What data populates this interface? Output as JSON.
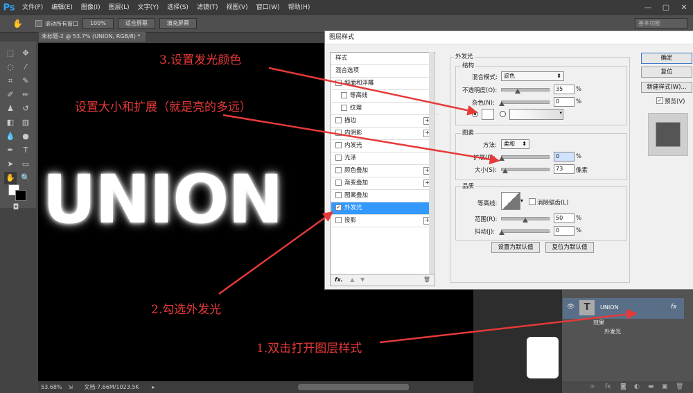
{
  "app": {
    "logo": "Ps"
  },
  "menubar": {
    "items": [
      "文件(F)",
      "编辑(E)",
      "图像(I)",
      "图层(L)",
      "文字(Y)",
      "选择(S)",
      "滤镜(T)",
      "视图(V)",
      "窗口(W)",
      "帮助(H)"
    ]
  },
  "window_controls": {
    "min": "—",
    "max": "▢",
    "close": "✕"
  },
  "options_bar": {
    "checkbox_label": "滚动所有窗口",
    "zoom_btn": "100%",
    "fit_btn": "适合屏幕",
    "fill_btn": "填充屏幕",
    "workspace": "基本功能"
  },
  "document": {
    "tab": "未标题-2 @ 53.7% (UNION, RGB/8) *",
    "canvas_text": "UNION",
    "status_zoom": "53.68%",
    "status_doc": "文档:7.66M/1023.5K"
  },
  "dialog": {
    "title": "图层样式",
    "styles": [
      {
        "label": "样式",
        "checkbox": false,
        "plus": false
      },
      {
        "label": "混合选项",
        "checkbox": false,
        "plus": false
      },
      {
        "label": "斜面和浮雕",
        "checkbox": true,
        "plus": false
      },
      {
        "label": "等高线",
        "checkbox": true,
        "plus": false
      },
      {
        "label": "纹理",
        "checkbox": true,
        "plus": false
      },
      {
        "label": "描边",
        "checkbox": true,
        "plus": true
      },
      {
        "label": "内阴影",
        "checkbox": true,
        "plus": true
      },
      {
        "label": "内发光",
        "checkbox": true,
        "plus": false
      },
      {
        "label": "光泽",
        "checkbox": true,
        "plus": false
      },
      {
        "label": "颜色叠加",
        "checkbox": true,
        "plus": true
      },
      {
        "label": "渐变叠加",
        "checkbox": true,
        "plus": true
      },
      {
        "label": "图案叠加",
        "checkbox": true,
        "plus": false
      },
      {
        "label": "外发光",
        "checkbox": true,
        "plus": false,
        "selected": true
      },
      {
        "label": "投影",
        "checkbox": true,
        "plus": true
      }
    ],
    "footer_fx": "fx.",
    "section_title": "外发光",
    "structure": {
      "title": "结构",
      "blend_label": "混合模式:",
      "blend_value": "滤色",
      "opacity_label": "不透明度(O):",
      "opacity_value": "35",
      "noise_label": "杂色(N):",
      "noise_value": "0",
      "pct": "%"
    },
    "elements": {
      "title": "图素",
      "method_label": "方法:",
      "method_value": "柔和",
      "spread_label": "扩展(P):",
      "spread_value": "0",
      "size_label": "大小(S):",
      "size_value": "73",
      "px": "像素"
    },
    "quality": {
      "title": "品质",
      "contour_label": "等高线:",
      "antialias_label": "消除锯齿(L)",
      "range_label": "范围(R):",
      "range_value": "50",
      "jitter_label": "抖动(J):",
      "jitter_value": "0"
    },
    "default_btn": "设置为默认值",
    "reset_default_btn": "复位为默认值",
    "ok": "确定",
    "reset": "复位",
    "new_style": "新建样式(W)...",
    "preview": "预览(V)"
  },
  "layers": {
    "layer_name": "UNION",
    "fx": "fx",
    "effect1": "效果",
    "effect2": "外发光"
  },
  "annotations": {
    "a3": "3.设置发光颜色",
    "a_size": "设置大小和扩展（就是亮的多远）",
    "a2": "2.勾选外发光",
    "a1": "1.双击打开图层样式"
  },
  "colors": {
    "annotation": "#e63939",
    "selected": "#3399ff",
    "ps_blue": "#2fa3f5"
  }
}
